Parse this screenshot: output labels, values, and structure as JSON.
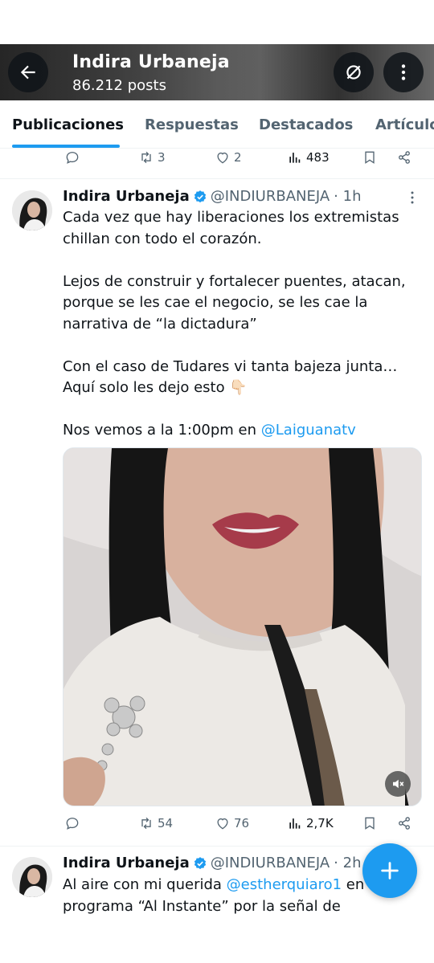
{
  "header": {
    "name": "Indira Urbaneja",
    "posts": "86.212 posts"
  },
  "tabs": [
    {
      "label": "Publicaciones"
    },
    {
      "label": "Respuestas"
    },
    {
      "label": "Destacados"
    },
    {
      "label": "Artículos"
    }
  ],
  "prev_post_actions": {
    "reposts": "3",
    "likes": "2",
    "views": "483"
  },
  "tweet1": {
    "name": "Indira Urbaneja",
    "handle": "@INDIURBANEJA",
    "time": "· 1h",
    "p1": "Cada vez que hay liberaciones los extremistas chillan con todo el corazón.",
    "p2": "Lejos de construir y fortalecer puentes, atacan, porque se les cae el negocio, se les cae la narrativa de “la dictadura”",
    "p3": "Con el caso de Tudares vi tanta bajeza junta… Aquí solo les dejo esto 👇🏻",
    "p4_prefix": "Nos vemos a la 1:00pm en ",
    "p4_mention": "@Laiguanatv",
    "reposts": "54",
    "likes": "76",
    "views": "2,7K"
  },
  "tweet2": {
    "name": "Indira Urbaneja",
    "handle": "@INDIURBANEJA",
    "time": "· 2h",
    "l1_prefix": "Al aire con mi querida ",
    "l1_mention": "@estherquiaro1",
    "l1_suffix": " en su",
    "l2": "programa “Al Instante” por la señal de"
  },
  "colors": {
    "accent": "#1d9bf0",
    "text": "#0f1419",
    "secondary": "#536471"
  },
  "icons": [
    "back-arrow-icon",
    "no-notification-icon",
    "more-vertical-icon",
    "reply-icon",
    "repost-icon",
    "like-icon",
    "views-icon",
    "bookmark-icon",
    "share-icon",
    "verified-icon",
    "mute-icon",
    "plus-icon"
  ]
}
